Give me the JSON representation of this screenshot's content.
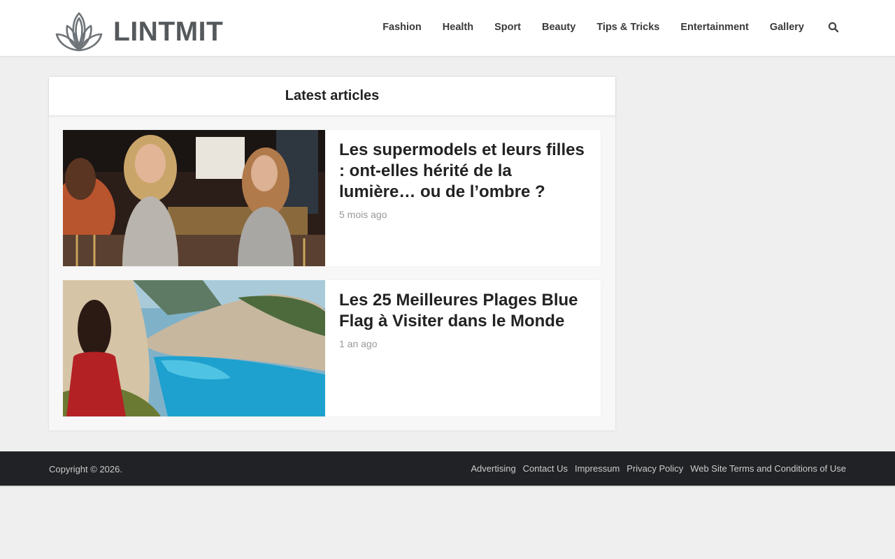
{
  "header": {
    "logo_text": "LINTMIT",
    "nav": [
      "Fashion",
      "Health",
      "Sport",
      "Beauty",
      "Tips & Tricks",
      "Entertainment",
      "Gallery"
    ]
  },
  "main": {
    "title": "Latest articles",
    "articles": [
      {
        "title": "Les supermodels et leurs filles : ont-elles hérité de la lumière… ou de l’ombre ?",
        "date": "5 mois ago"
      },
      {
        "title": "Les 25 Meilleures Plages Blue Flag à Visiter dans le Monde",
        "date": "1 an ago"
      }
    ]
  },
  "footer": {
    "copyright": "Copyright © 2026.",
    "links": [
      "Advertising",
      "Contact Us",
      "Impressum",
      "Privacy Policy",
      "Web Site Terms and Conditions of Use"
    ]
  },
  "icons": {
    "logo": "lotus-icon",
    "search": "search-icon"
  }
}
